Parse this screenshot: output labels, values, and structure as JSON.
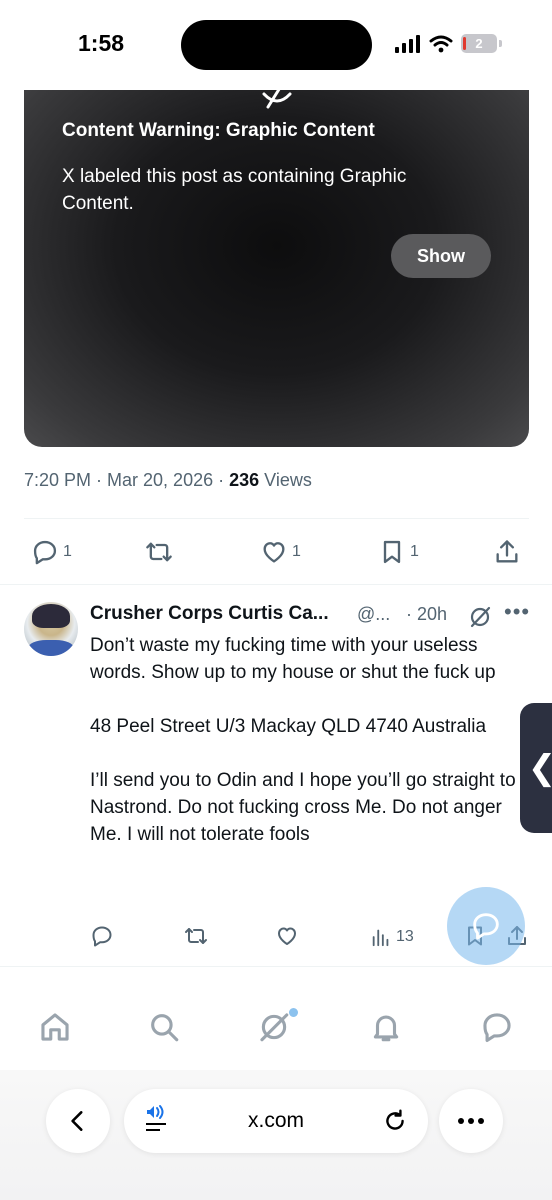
{
  "status_bar": {
    "time": "1:58",
    "battery_level": "2"
  },
  "content_warning": {
    "title": "Content Warning: Graphic Content",
    "body": "X labeled this post as containing Graphic Content.",
    "show_label": "Show"
  },
  "post_meta": {
    "time_date": "7:20 PM · Mar 20, 2026 · ",
    "views_count": "236",
    "views_label": " Views"
  },
  "post_actions": {
    "replies": "1",
    "likes": "1",
    "bookmarks": "1"
  },
  "reply": {
    "name": "Crusher Corps Curtis Ca...",
    "handle": "@...",
    "time": "· 20h",
    "paragraphs": [
      "Don’t waste my fucking time with your useless words. Show up to my house or shut the fuck up",
      "48 Peel Street U/3 Mackay QLD 4740 Australia",
      "I’ll send you to Odin and I hope you’ll go straight to Nastrond. Do not fucking cross Me. Do not anger Me. I will not tolerate fools"
    ],
    "views": "13"
  },
  "side_tab": {
    "glyph": "❮"
  },
  "browser": {
    "url": "x.com"
  },
  "icons": {
    "nav": [
      "home-icon",
      "search-icon",
      "grok-icon",
      "notifications-icon",
      "messages-icon"
    ]
  }
}
